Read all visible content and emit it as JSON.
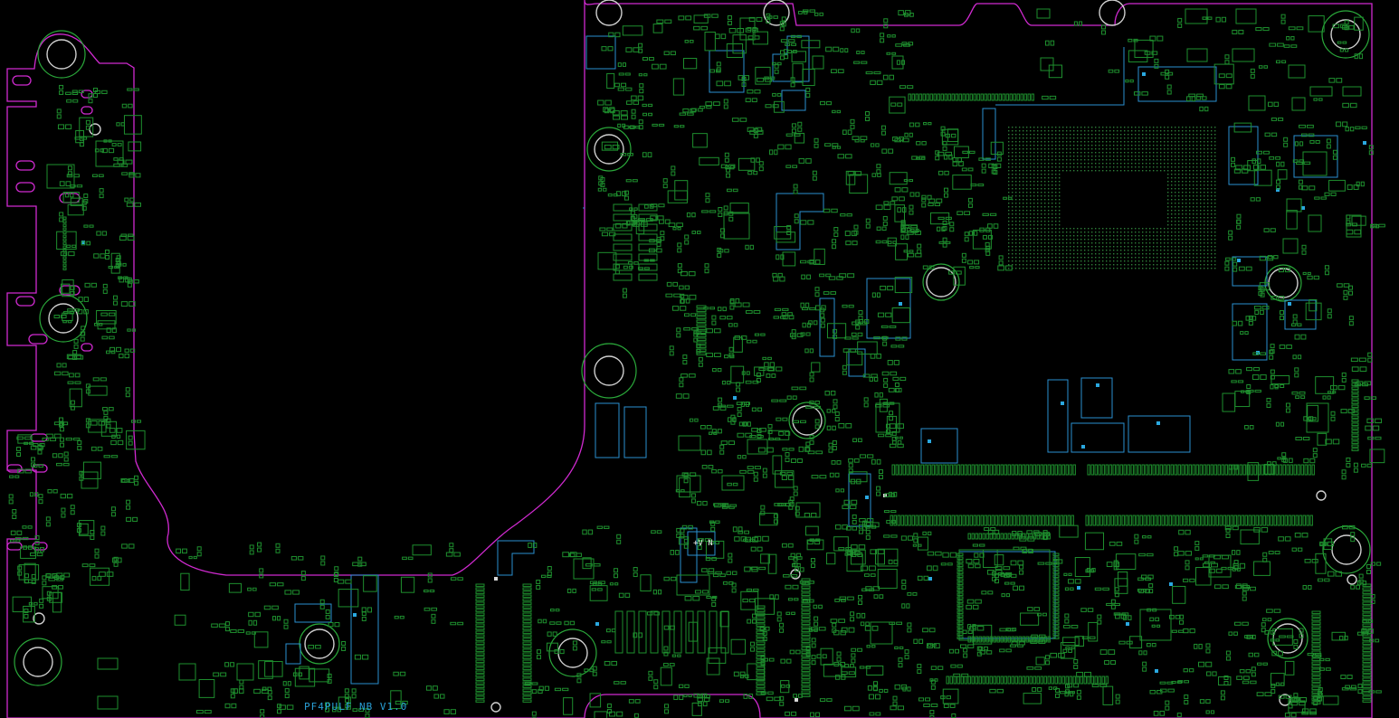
{
  "board": {
    "name_label": "PF4PULF NB V1.0",
    "net_label": "+V N"
  },
  "colors": {
    "background": "#000000",
    "board_outline": "#d02ad0",
    "component_pads": "#1e8f2e",
    "copper_areas": "#2a8fd0",
    "mounting_holes": "#cfcfcf"
  }
}
